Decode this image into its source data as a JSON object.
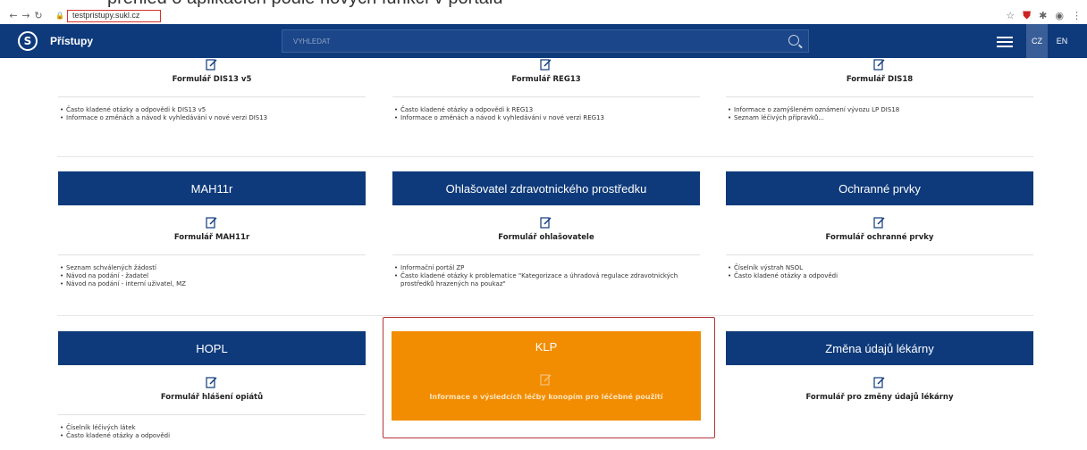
{
  "page_caption": "přehled o aplikacích podle nových funkcí v portálu",
  "browser": {
    "url": "testpristupy.sukl.cz"
  },
  "header": {
    "brand": "Přístupy",
    "search_placeholder": "VYHLEDAT",
    "lang_cz": "CZ",
    "lang_en": "EN"
  },
  "colors": {
    "header_bg": "#0e3a7b",
    "klp_orange": "#f28c00",
    "highlight_red": "#b5333a"
  },
  "top_row": [
    {
      "form_link": "Formulář DIS13 v5",
      "links": [
        "Často kladené otázky a odpovědi k DIS13 v5",
        "Informace o změnách a návod k vyhledávání v nové verzi DIS13"
      ]
    },
    {
      "form_link": "Formulář REG13",
      "links": [
        "Často kladené otázky a odpovědi k REG13",
        "Informace o změnách a návod k vyhledávání v nové verzi REG13"
      ]
    },
    {
      "form_link": "Formulář DIS18",
      "links": [
        "Informace o zamýšleném oznámení vývozu LP DIS18",
        "Seznam léčivých přípravků..."
      ]
    }
  ],
  "middle_row": [
    {
      "title": "MAH11r",
      "form_link": "Formulář MAH11r",
      "links": [
        "Seznam schválených žádostí",
        "Návod na podání - žadatel",
        "Návod na podání - interní uživatel, MZ"
      ]
    },
    {
      "title": "Ohlašovatel zdravotnického prostředku",
      "form_link": "Formulář ohlašovatele",
      "links": [
        "Informační portál ZP",
        "Často kladené otázky k problematice \"Kategorizace a úhradová regulace zdravotnických prostředků hrazených na poukaz\""
      ]
    },
    {
      "title": "Ochranné prvky",
      "form_link": "Formulář ochranné prvky",
      "links": [
        "Číselník výstrah NSOL",
        "Často kladené otázky a odpovědi"
      ]
    }
  ],
  "bottom_row": [
    {
      "title": "HOPL",
      "form_link": "Formulář hlášení opiátů",
      "links": [
        "Číselník léčivých látek",
        "Často kladené otázky a odpovědi"
      ]
    },
    {
      "title": "KLP",
      "form_link": "Informace o výsledcích léčby konopím pro léčebné použití"
    },
    {
      "title": "Změna údajů lékárny",
      "form_link": "Formulář pro změny údajů lékárny"
    }
  ]
}
